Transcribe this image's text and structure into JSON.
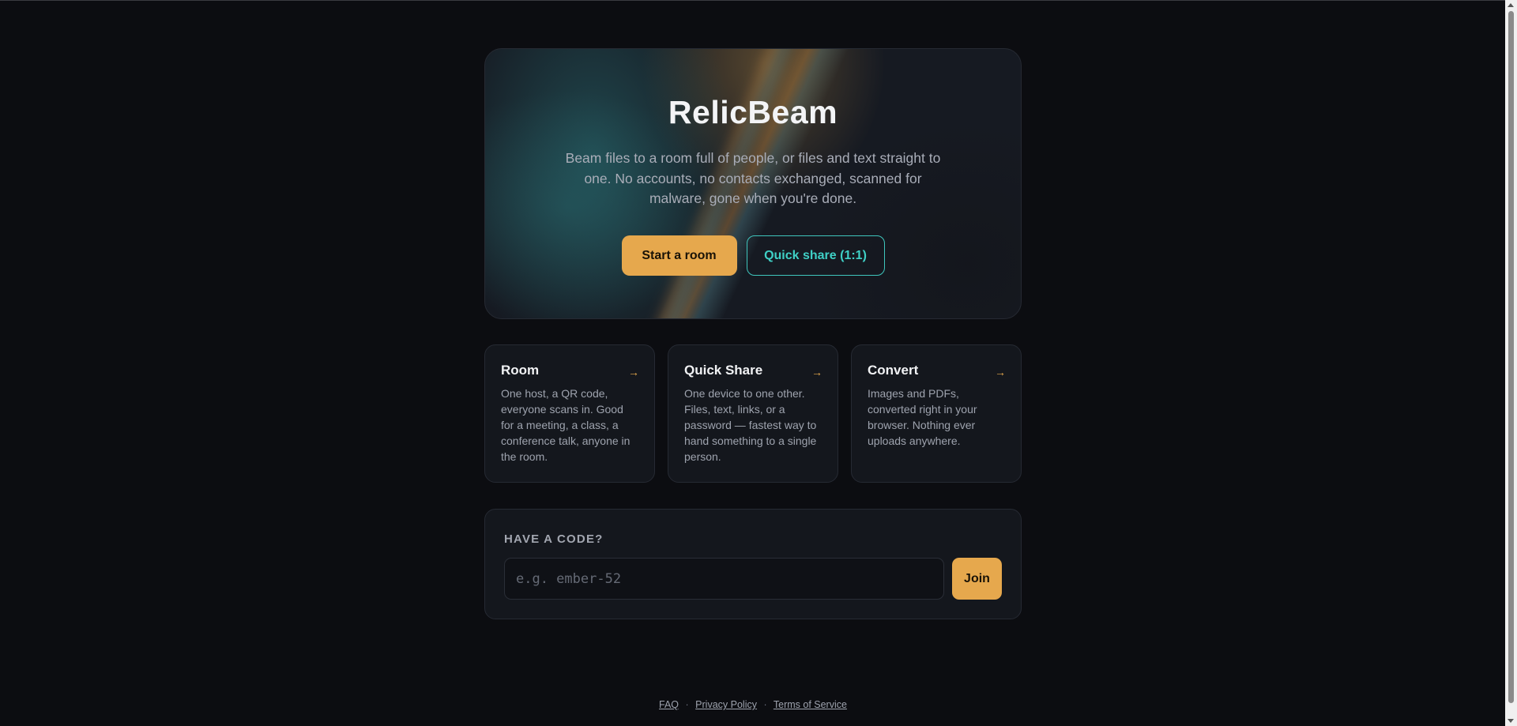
{
  "hero": {
    "title": "RelicBeam",
    "description": "Beam files to a room full of people, or files and text straight to one. No accounts, no contacts exchanged, scanned for malware, gone when you're done.",
    "primary_button": "Start a room",
    "secondary_button": "Quick share (1:1)"
  },
  "cards": [
    {
      "title": "Room",
      "arrow": "→",
      "description": "One host, a QR code, everyone scans in. Good for a meeting, a class, a conference talk, anyone in the room."
    },
    {
      "title": "Quick Share",
      "arrow": "→",
      "description": "One device to one other. Files, text, links, or a password — fastest way to hand something to a single person."
    },
    {
      "title": "Convert",
      "arrow": "→",
      "description": "Images and PDFs, converted right in your browser. Nothing ever uploads anywhere."
    }
  ],
  "code": {
    "label": "HAVE A CODE?",
    "placeholder": "e.g. ember-52",
    "value": "",
    "join_button": "Join"
  },
  "footer": {
    "links": [
      "FAQ",
      "Privacy Policy",
      "Terms of Service"
    ],
    "separator": "·"
  },
  "colors": {
    "background": "#0c0d11",
    "accent_amber": "#e6a84d",
    "accent_teal": "#3fc6bd",
    "card_bg": "#14171d"
  }
}
